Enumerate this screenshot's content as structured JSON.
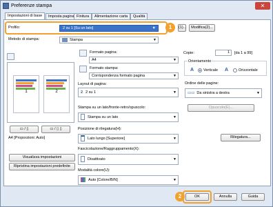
{
  "window": {
    "title": "Preferenze stampa",
    "close_glyph": "✕"
  },
  "tabs": [
    {
      "label": "Impostazioni di base"
    },
    {
      "label": "Imposta pagina"
    },
    {
      "label": "Finitura"
    },
    {
      "label": "Alimentazione carta"
    },
    {
      "label": "Qualità"
    }
  ],
  "profile": {
    "label": "Profilo:",
    "value": "2 su 1 [Su un lato]",
    "edit_button": "Modifica(2)...",
    "partial_button": "(1)..."
  },
  "output_method": {
    "label": "Metodo di stampa:",
    "value": "Stampa"
  },
  "preview": {
    "pages": [
      "1",
      "2"
    ],
    "caption": "A4 [Proporzioni: Auto]",
    "show_settings_button": "Visualizza impostazioni",
    "restore_defaults_button": "Ripristina impostazioni predefinite"
  },
  "page_size": {
    "label": "Formato pagina:",
    "value": "A4"
  },
  "output_size": {
    "label": "Formato stampa:",
    "value": "Corrispondenza formato pagina"
  },
  "layout": {
    "label": "Layout di pagina:",
    "value": "2 su 1"
  },
  "duplex": {
    "label": "Stampa su un lato/fronte-retro/opuscolo:",
    "value": "Stampa su un lato"
  },
  "binding": {
    "label": "Posizione di rilegatura(H):",
    "value": "Lato lungo [Superiore]",
    "button": "Rilegatura..."
  },
  "collate": {
    "label": "Fascicolazione/Raggruppamento(X):",
    "value": "Disattivato"
  },
  "color_mode": {
    "label": "Modalità colore(U):",
    "value": "Auto [Colore/B/N]"
  },
  "copies": {
    "label": "Copie:",
    "value": "1",
    "range": "[da 1 a 99]"
  },
  "orientation": {
    "label": "Orientamento",
    "portrait": "Verticale",
    "landscape": "Orizzontale"
  },
  "page_order": {
    "label": "Ordine delle pagine:",
    "value": "Da sinistra a destra"
  },
  "booklet_button": "Opuscolo(E)...",
  "footer": {
    "ok": "OK",
    "cancel": "Annulla",
    "help": "Guida"
  },
  "callouts": [
    "1",
    "2"
  ],
  "colors": {
    "accent": "#f3a12e",
    "selection": "#3b73c8"
  }
}
